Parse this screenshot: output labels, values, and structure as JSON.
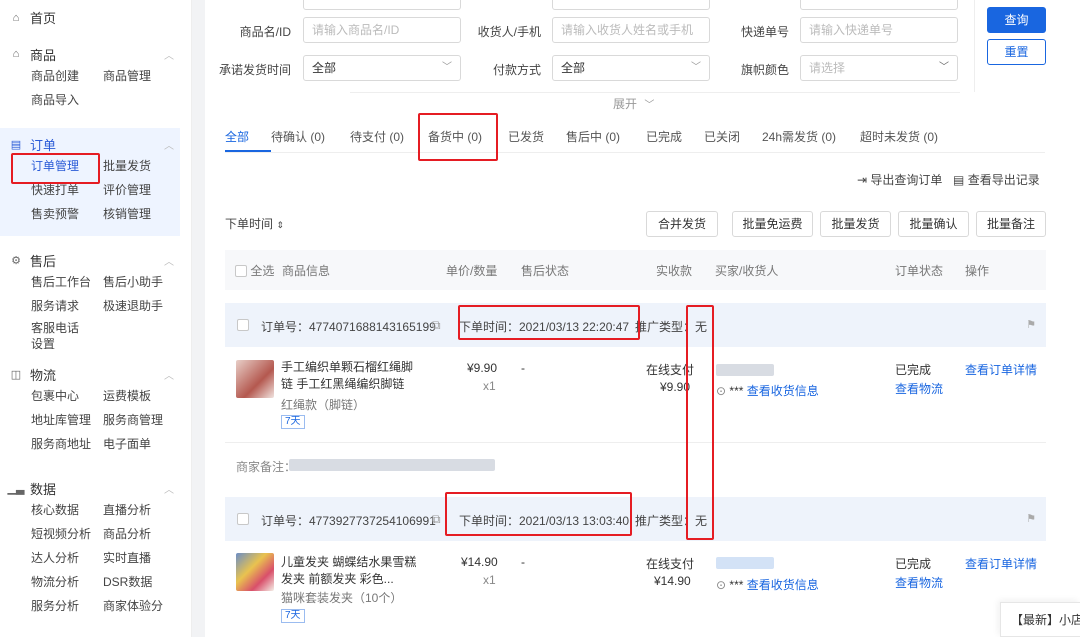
{
  "sidebar": {
    "home": "首页",
    "sections": [
      {
        "title": "商品",
        "items": [
          "商品创建",
          "商品管理",
          "商品导入"
        ]
      },
      {
        "title": "订单",
        "items": [
          "订单管理",
          "批量发货",
          "快速打单",
          "评价管理",
          "售卖预警",
          "核销管理"
        ]
      },
      {
        "title": "售后",
        "items": [
          "售后工作台",
          "售后小助手",
          "服务请求",
          "极速退助手",
          "客服电话设置"
        ]
      },
      {
        "title": "物流",
        "items": [
          "包裹中心",
          "运费模板",
          "地址库管理",
          "服务商管理",
          "服务商地址",
          "电子面单"
        ]
      },
      {
        "title": "数据",
        "items": [
          "核心数据",
          "直播分析",
          "短视频分析",
          "商品分析",
          "达人分析",
          "实时直播",
          "物流分析",
          "DSR数据",
          "服务分析",
          "商家体验分"
        ]
      }
    ]
  },
  "filters": {
    "product_label": "商品名/ID",
    "product_placeholder": "请输入商品名/ID",
    "receiver_label": "收货人/手机",
    "receiver_placeholder": "请输入收货人姓名或手机",
    "express_label": "快递单号",
    "express_placeholder": "请输入快递单号",
    "promise_label": "承诺发货时间",
    "promise_value": "全部",
    "pay_label": "付款方式",
    "pay_value": "全部",
    "flag_label": "旗帜颜色",
    "flag_placeholder": "请选择",
    "query_btn": "查询",
    "reset_btn": "重置",
    "expand": "展开"
  },
  "tabs": [
    {
      "label": "全部"
    },
    {
      "label": "待确认 (0)"
    },
    {
      "label": "待支付 (0)"
    },
    {
      "label": "备货中 (0)"
    },
    {
      "label": "已发货"
    },
    {
      "label": "售后中 (0)"
    },
    {
      "label": "已完成"
    },
    {
      "label": "已关闭"
    },
    {
      "label": "24h需发货 (0)"
    },
    {
      "label": "超时未发货 (0)"
    }
  ],
  "export": {
    "query_export": "导出查询订单",
    "view_records": "查看导出记录"
  },
  "sort_label": "下单时间",
  "actions": [
    "合并发货",
    "批量免运费",
    "批量发货",
    "批量确认",
    "批量备注"
  ],
  "table_header": {
    "select_all": "全选",
    "product": "商品信息",
    "price_qty": "单价/数量",
    "after_sale": "售后状态",
    "paid": "实收款",
    "buyer": "买家/收货人",
    "status": "订单状态",
    "operation": "操作"
  },
  "orders": [
    {
      "order_no": "订单号：4774071688143165199",
      "order_time": "下单时间：2021/03/13 22:20:47",
      "promo": "推广类型：无",
      "product_name": "手工编织单颗石榴红绳脚链 手工红黑绳编织脚链",
      "sku": "红绳款（脚链）",
      "tag": "7天",
      "price": "¥9.90",
      "qty": "x1",
      "after_sale": "-",
      "pay_method": "在线支付",
      "paid": "¥9.90",
      "buyer_masked": "***",
      "view_receiver": "查看收货信息",
      "status": "已完成",
      "view_logistics": "查看物流",
      "view_detail": "查看订单详情",
      "remark_label": "商家备注："
    },
    {
      "order_no": "订单号：4773927737254106991",
      "order_time": "下单时间：2021/03/13 13:03:40",
      "promo": "推广类型：无",
      "product_name": "儿童发夹 蝴蝶结水果雪糕发夹 前额发夹 彩色...",
      "sku": "猫咪套装发夹（10个）",
      "tag": "7天",
      "price": "¥14.90",
      "qty": "x1",
      "after_sale": "-",
      "pay_method": "在线支付",
      "paid": "¥14.90",
      "buyer_masked": "***",
      "view_receiver": "查看收货信息",
      "status": "已完成",
      "view_logistics": "查看物流",
      "view_detail": "查看订单详情"
    }
  ],
  "notice": "【最新】小店帮"
}
